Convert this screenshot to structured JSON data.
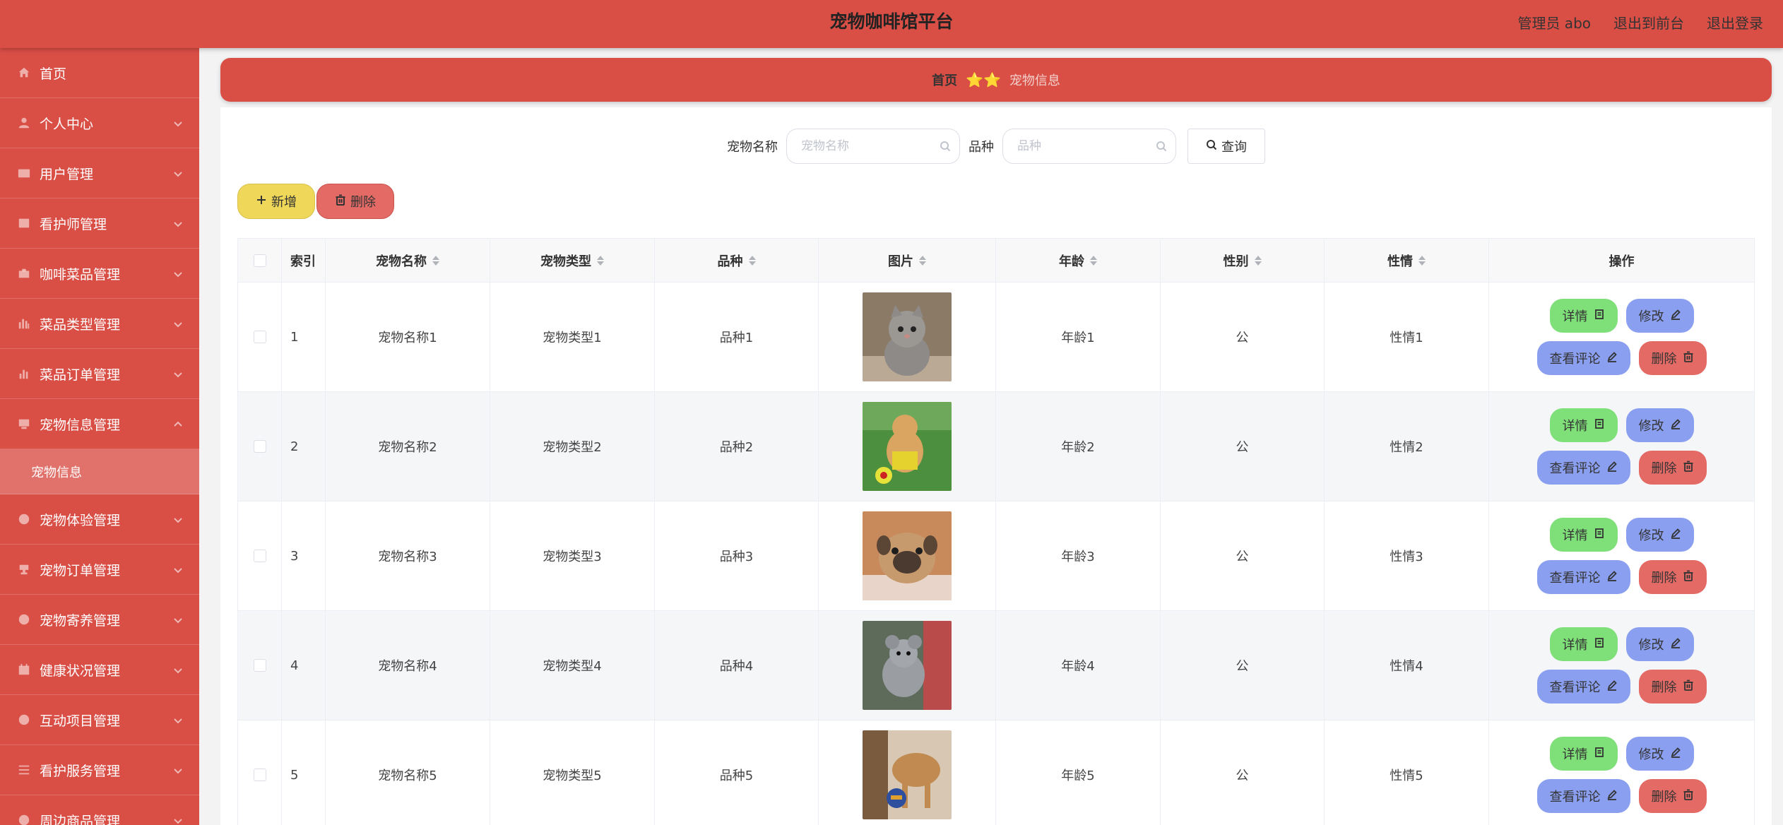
{
  "app": {
    "title": "宠物咖啡馆平台",
    "user_label": "管理员 abo",
    "front_label": "退出到前台",
    "logout_label": "退出登录"
  },
  "sidebar": {
    "items": [
      {
        "label": "首页",
        "icon": "home-icon"
      },
      {
        "label": "个人中心",
        "icon": "user-icon"
      },
      {
        "label": "用户管理",
        "icon": "id-card-icon"
      },
      {
        "label": "看护师管理",
        "icon": "picture-icon"
      },
      {
        "label": "咖啡菜品管理",
        "icon": "briefcase-icon"
      },
      {
        "label": "菜品类型管理",
        "icon": "bar-chart-icon"
      },
      {
        "label": "菜品订单管理",
        "icon": "data-analysis-icon"
      },
      {
        "label": "宠物信息管理",
        "icon": "monitor-icon"
      },
      {
        "label": "宠物体验管理",
        "icon": "compass-icon"
      },
      {
        "label": "宠物订单管理",
        "icon": "cup-icon"
      },
      {
        "label": "宠物寄养管理",
        "icon": "basketball-icon"
      },
      {
        "label": "健康状况管理",
        "icon": "calendar-icon"
      },
      {
        "label": "互动项目管理",
        "icon": "clock-icon"
      },
      {
        "label": "看护服务管理",
        "icon": "list-icon"
      },
      {
        "label": "周边商品管理",
        "icon": "goods-icon"
      }
    ],
    "sub_active": "宠物信息"
  },
  "breadcrumb": {
    "home": "首页",
    "stars": "⭐⭐",
    "current": "宠物信息"
  },
  "search": {
    "name_label": "宠物名称",
    "name_placeholder": "宠物名称",
    "breed_label": "品种",
    "breed_placeholder": "品种",
    "query_label": "查询"
  },
  "actions": {
    "add_label": "新增",
    "delete_label": "删除"
  },
  "table": {
    "headers": {
      "index": "索引",
      "name": "宠物名称",
      "type": "宠物类型",
      "breed": "品种",
      "image": "图片",
      "age": "年龄",
      "sex": "性别",
      "temper": "性情",
      "ops": "操作"
    },
    "rows": [
      {
        "index": "1",
        "name": "宠物名称1",
        "type": "宠物类型1",
        "breed": "品种1",
        "age": "年龄1",
        "sex": "公",
        "temper": "性情1"
      },
      {
        "index": "2",
        "name": "宠物名称2",
        "type": "宠物类型2",
        "breed": "品种2",
        "age": "年龄2",
        "sex": "公",
        "temper": "性情2"
      },
      {
        "index": "3",
        "name": "宠物名称3",
        "type": "宠物类型3",
        "breed": "品种3",
        "age": "年龄3",
        "sex": "公",
        "temper": "性情3"
      },
      {
        "index": "4",
        "name": "宠物名称4",
        "type": "宠物类型4",
        "breed": "品种4",
        "age": "年龄4",
        "sex": "公",
        "temper": "性情4"
      },
      {
        "index": "5",
        "name": "宠物名称5",
        "type": "宠物类型5",
        "breed": "品种5",
        "age": "年龄5",
        "sex": "公",
        "temper": "性情5"
      }
    ],
    "row_buttons": {
      "detail": "详情",
      "edit": "修改",
      "review": "查看评论",
      "remove": "删除"
    }
  },
  "colors": {
    "primary": "#d94f46",
    "add_button": "#eed759",
    "delete_button": "#e36a65",
    "detail_button": "#7fe07a",
    "edit_button": "#8b9ff0"
  }
}
